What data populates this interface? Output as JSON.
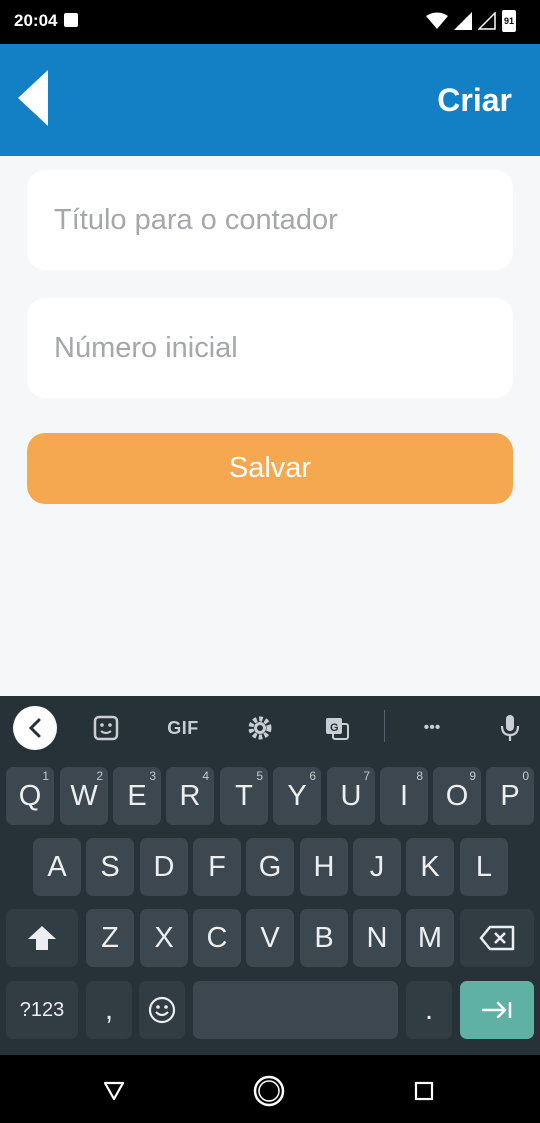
{
  "status_bar": {
    "time": "20:04",
    "battery": "91"
  },
  "app_bar": {
    "action_label": "Criar"
  },
  "form": {
    "title_placeholder": "Título para o contador",
    "title_value": "",
    "number_placeholder": "Número inicial",
    "number_value": "",
    "save_label": "Salvar"
  },
  "keyboard": {
    "toolbar": {
      "gif_label": "GIF",
      "more_label": "•••"
    },
    "row1": [
      {
        "label": "Q",
        "hint": "1"
      },
      {
        "label": "W",
        "hint": "2"
      },
      {
        "label": "E",
        "hint": "3"
      },
      {
        "label": "R",
        "hint": "4"
      },
      {
        "label": "T",
        "hint": "5"
      },
      {
        "label": "Y",
        "hint": "6"
      },
      {
        "label": "U",
        "hint": "7"
      },
      {
        "label": "I",
        "hint": "8"
      },
      {
        "label": "O",
        "hint": "9"
      },
      {
        "label": "P",
        "hint": "0"
      }
    ],
    "row2": [
      "A",
      "S",
      "D",
      "F",
      "G",
      "H",
      "J",
      "K",
      "L"
    ],
    "row3": [
      "Z",
      "X",
      "C",
      "V",
      "B",
      "N",
      "M"
    ],
    "symbols_label": "?123",
    "comma_label": ",",
    "period_label": "."
  },
  "colors": {
    "app_bar": "#1380c6",
    "save_button": "#f6a851",
    "keyboard_bg": "#273238",
    "enter_key": "#5fb1a3"
  }
}
